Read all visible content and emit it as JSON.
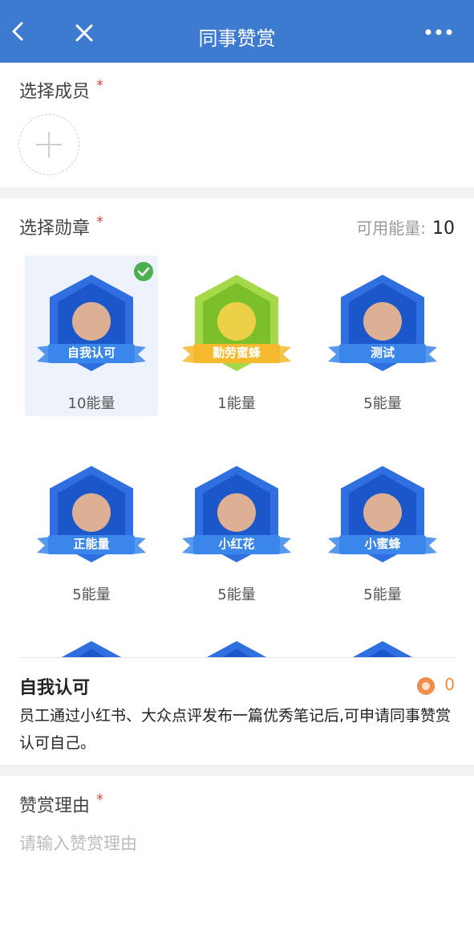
{
  "navbar": {
    "title": "同事赞赏",
    "back_icon": "chevron-left-icon",
    "close_icon": "close-icon",
    "more_icon": "more-dots-icon"
  },
  "member": {
    "label": "选择成员",
    "required_mark": "*",
    "add_icon": "plus-icon"
  },
  "medals": {
    "label": "选择勋章",
    "required_mark": "*",
    "energy_label": "可用能量:",
    "energy_value": "10",
    "items": [
      {
        "name": "自我认可",
        "cost": "10能量",
        "selected": true,
        "icon": "handshake-icon",
        "color": "#2f6fe0"
      },
      {
        "name": "勤劳蜜蜂",
        "cost": "1能量",
        "selected": false,
        "icon": "bee-honeycomb-icon",
        "color": "#8cc63f"
      },
      {
        "name": "测试",
        "cost": "5能量",
        "selected": false,
        "icon": "handshake-icon",
        "color": "#2f6fe0"
      },
      {
        "name": "正能量",
        "cost": "5能量",
        "selected": false,
        "icon": "smiley-sun-icon",
        "color": "#2f6fe0"
      },
      {
        "name": "小红花",
        "cost": "5能量",
        "selected": false,
        "icon": "red-flower-icon",
        "color": "#2f6fe0"
      },
      {
        "name": "小蜜蜂",
        "cost": "5能量",
        "selected": false,
        "icon": "bee-icon",
        "color": "#2f6fe0"
      },
      {
        "name": "",
        "cost": "",
        "selected": false,
        "icon": "person-hat-icon",
        "color": "#2f6fe0"
      },
      {
        "name": "",
        "cost": "",
        "selected": false,
        "icon": "trophy-icon",
        "color": "#2f6fe0"
      },
      {
        "name": "",
        "cost": "",
        "selected": false,
        "icon": "graduate-icon",
        "color": "#2f6fe0"
      }
    ]
  },
  "detail": {
    "title": "自我认可",
    "coin_value": "0",
    "description": "员工通过小红书、大众点评发布一篇优秀笔记后,可申请同事赞赏认可自己。"
  },
  "reason": {
    "label": "赞赏理由",
    "required_mark": "*",
    "placeholder": "请输入赞赏理由"
  },
  "colors": {
    "primary": "#3d7bd0",
    "required": "#e8473e",
    "check": "#4caf50",
    "coin": "#f08a3c"
  }
}
